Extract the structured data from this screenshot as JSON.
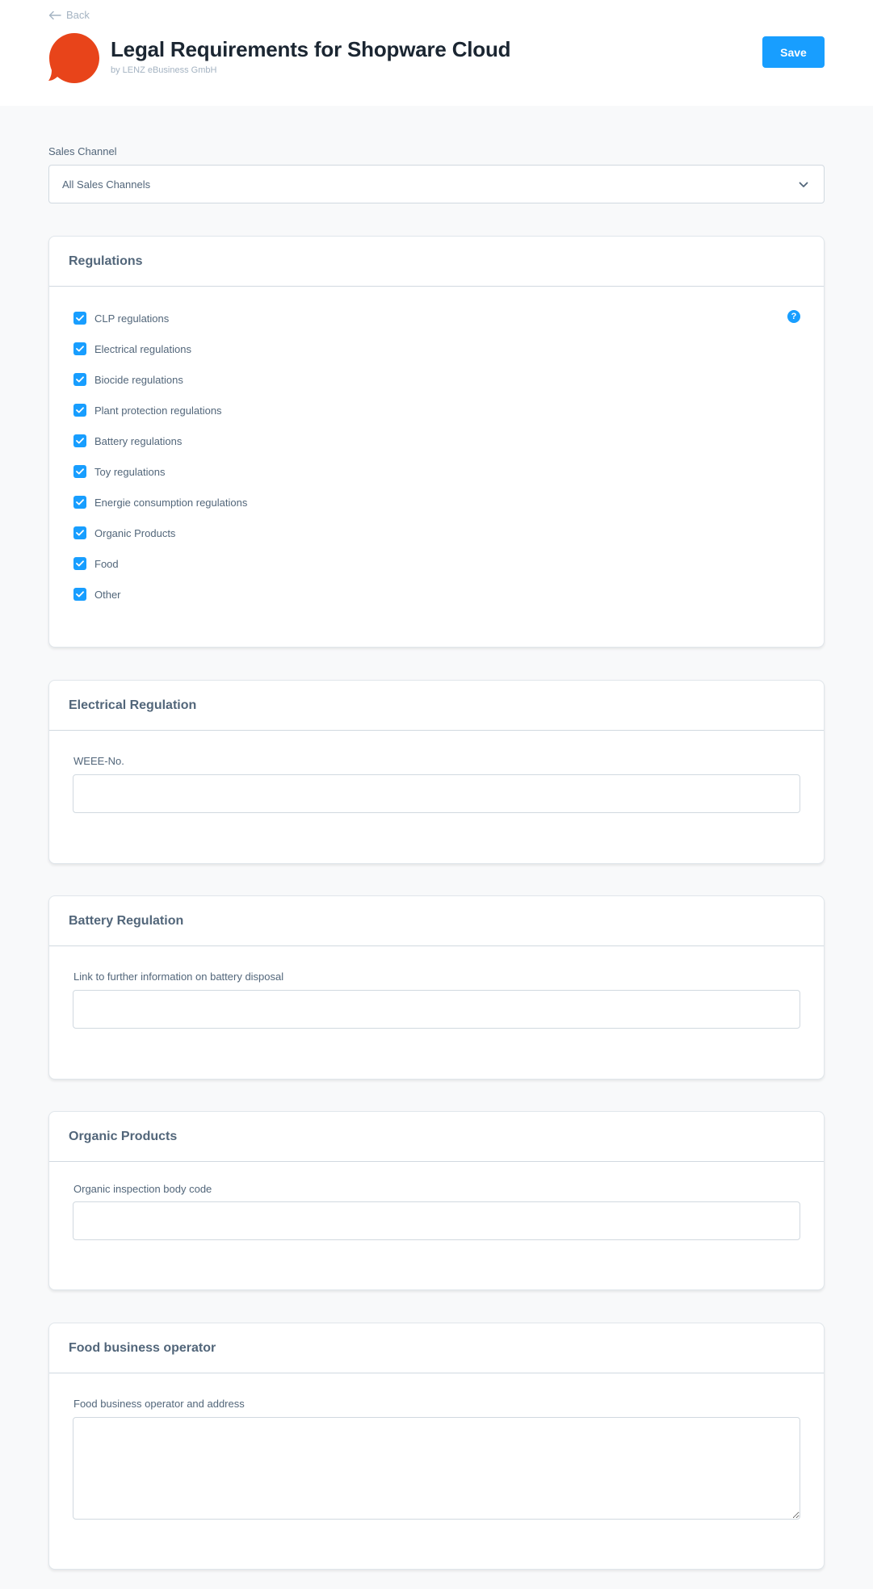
{
  "header": {
    "back_label": "Back",
    "title": "Legal Requirements for Shopware Cloud",
    "vendor": "by LENZ eBusiness GmbH",
    "save_label": "Save",
    "logo_color": "#e8441a",
    "accent_color": "#189eff"
  },
  "sales_channel": {
    "label": "Sales Channel",
    "selected": "All Sales Channels"
  },
  "regulations": {
    "title": "Regulations",
    "help_icon": "?",
    "items": [
      {
        "label": "CLP regulations",
        "checked": true
      },
      {
        "label": "Electrical regulations",
        "checked": true
      },
      {
        "label": "Biocide regulations",
        "checked": true
      },
      {
        "label": "Plant protection regulations",
        "checked": true
      },
      {
        "label": "Battery regulations",
        "checked": true
      },
      {
        "label": "Toy regulations",
        "checked": true
      },
      {
        "label": "Energie consumption regulations",
        "checked": true
      },
      {
        "label": "Organic Products",
        "checked": true
      },
      {
        "label": "Food",
        "checked": true
      },
      {
        "label": "Other",
        "checked": true
      }
    ]
  },
  "electrical": {
    "title": "Electrical Regulation",
    "field_label": "WEEE-No.",
    "value": ""
  },
  "battery": {
    "title": "Battery Regulation",
    "field_label": "Link to further information on battery disposal",
    "value": ""
  },
  "organic": {
    "title": "Organic Products",
    "field_label": "Organic inspection body code",
    "value": ""
  },
  "food": {
    "title": "Food business operator",
    "field_label": "Food business operator and address",
    "value": ""
  }
}
